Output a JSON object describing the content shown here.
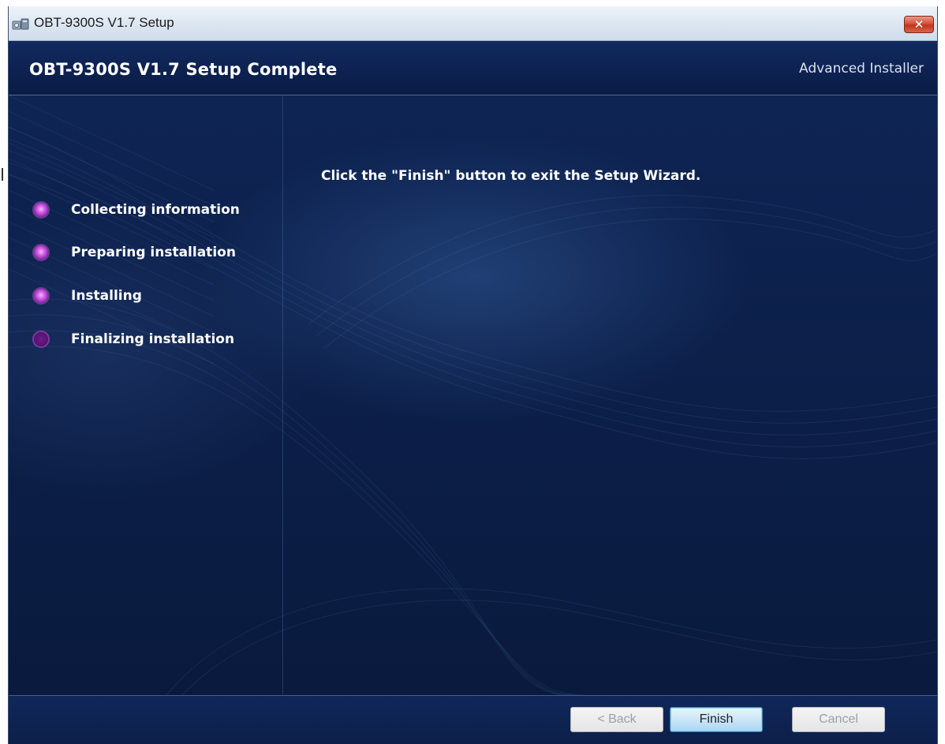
{
  "window": {
    "title": "OBT-9300S V1.7 Setup",
    "close_glyph": "✕"
  },
  "header": {
    "title": "OBT-9300S V1.7 Setup Complete",
    "brand": "Advanced Installer"
  },
  "main": {
    "message": "Click the \"Finish\" button to exit the Setup Wizard."
  },
  "steps": [
    {
      "label": "Collecting information",
      "state": "done"
    },
    {
      "label": "Preparing installation",
      "state": "done"
    },
    {
      "label": "Installing",
      "state": "done"
    },
    {
      "label": "Finalizing installation",
      "state": "current"
    }
  ],
  "footer": {
    "back_label": "< Back",
    "finish_label": "Finish",
    "cancel_label": "Cancel"
  },
  "colors": {
    "accent": "#d15ee8",
    "background": "#0c1f49"
  },
  "icons": {
    "app": "installer-app-icon",
    "close": "close-icon"
  }
}
